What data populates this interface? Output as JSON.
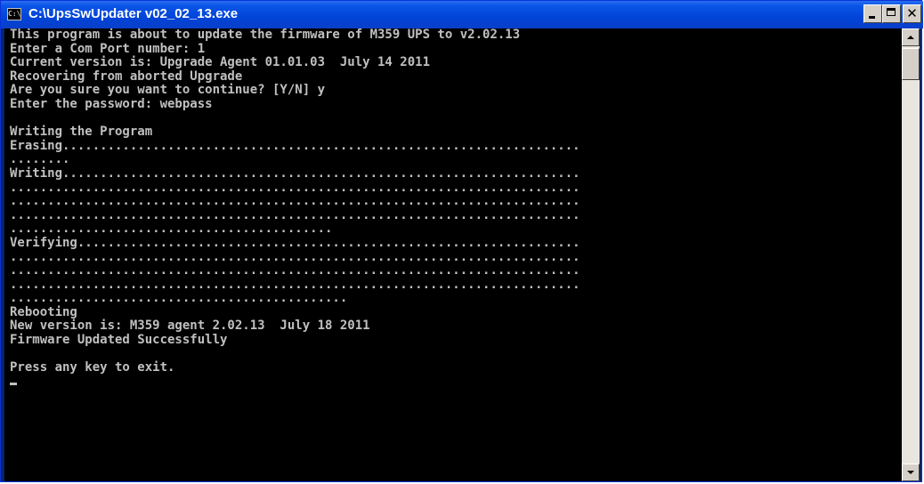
{
  "window": {
    "title": "C:\\UpsSwUpdater v02_02_13.exe",
    "icon": "console-icon",
    "icon_text": "C:\\",
    "buttons": {
      "minimize": "minimize-icon",
      "maximize": "maximize-icon",
      "close": "close-icon",
      "close_glyph": "✕"
    }
  },
  "console": {
    "foreground": "#c0c0c0",
    "background": "#000000",
    "lines": [
      "This program is about to update the firmware of M359 UPS to v2.02.13",
      "Enter a Com Port number: 1",
      "Current version is: Upgrade Agent 01.01.03  July 14 2011",
      "Recovering from aborted Upgrade",
      "Are you sure you want to continue? [Y/N] y",
      "Enter the password: webpass",
      "",
      "Writing the Program",
      "Erasing.....................................................................",
      "........",
      "Writing.....................................................................",
      "............................................................................",
      "............................................................................",
      "............................................................................",
      "...........................................",
      "Verifying...................................................................",
      "............................................................................",
      "............................................................................",
      "............................................................................",
      ".............................................",
      "Rebooting",
      "New version is: M359 agent 2.02.13  July 18 2011",
      "Firmware Updated Successfully",
      "",
      "Press any key to exit.",
      ""
    ]
  },
  "scrollbar": {
    "up_icon": "scroll-up-arrow-icon",
    "down_icon": "scroll-down-arrow-icon"
  }
}
